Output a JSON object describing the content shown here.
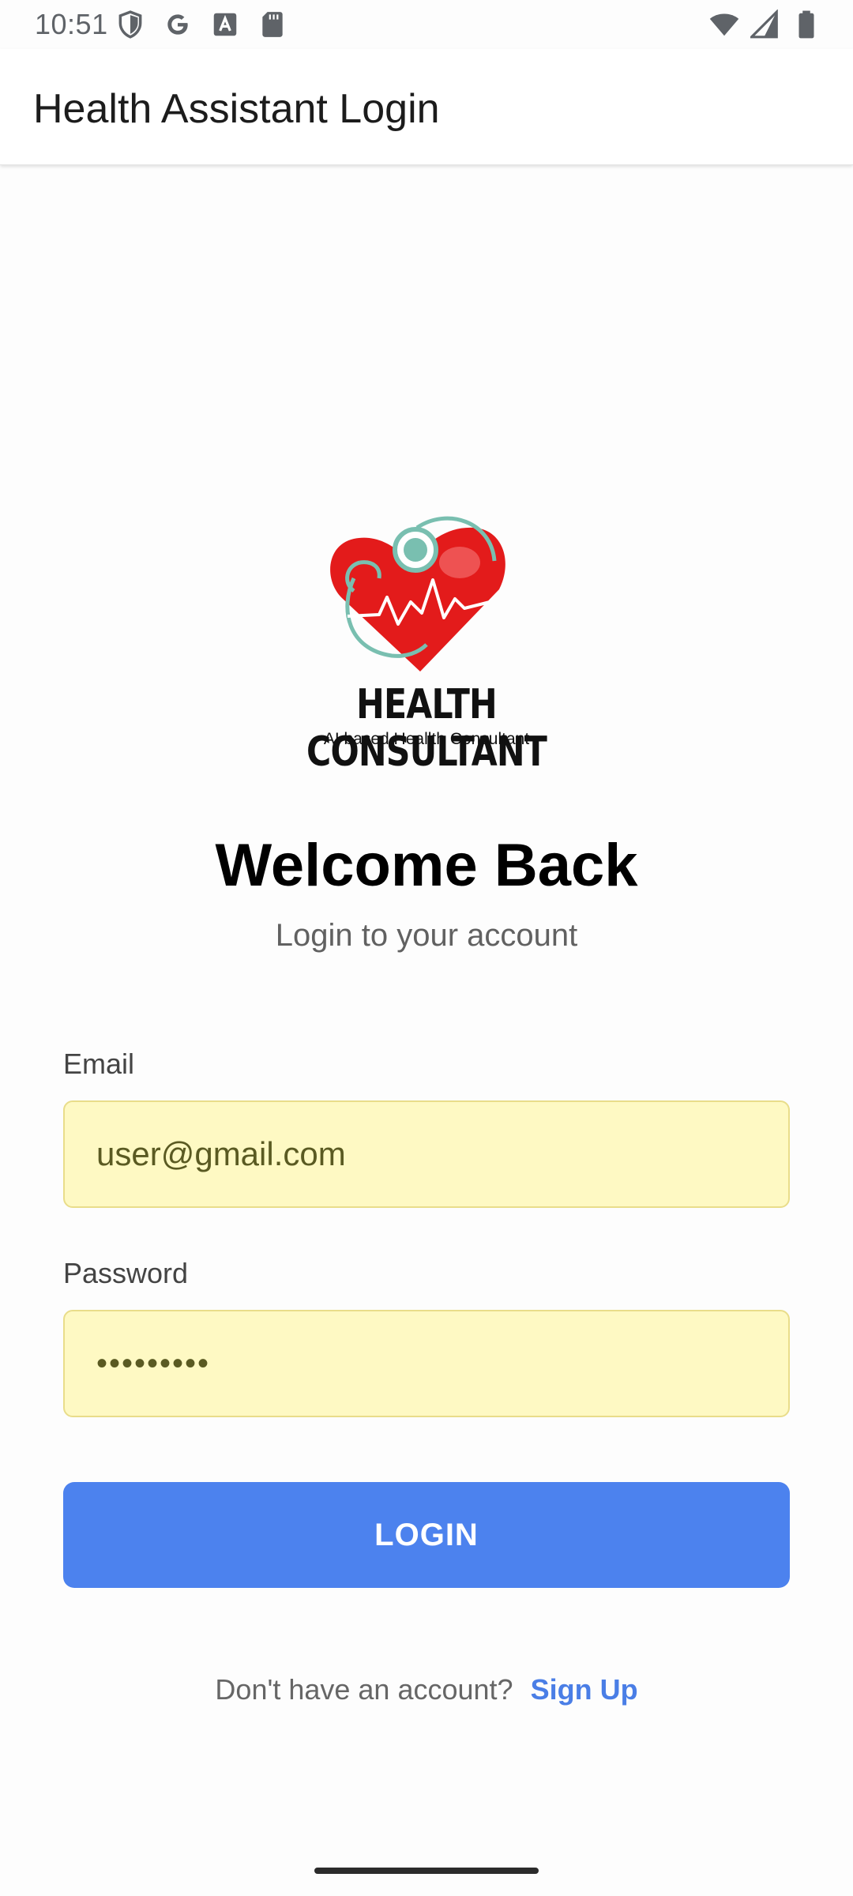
{
  "status_bar": {
    "time": "10:51",
    "left_icons": [
      "shield-icon",
      "google-icon",
      "font-icon",
      "sd-card-icon"
    ],
    "right_icons": [
      "wifi-icon",
      "signal-icon",
      "battery-icon"
    ]
  },
  "app_bar": {
    "title": "Health Assistant Login"
  },
  "logo": {
    "heading": "HEALTH CONSULTANT",
    "tagline": "AI based  Heallth Consultant",
    "colors": {
      "heart": "#e31b1b",
      "stethoscope": "#79bfb0"
    }
  },
  "welcome": {
    "title": "Welcome Back",
    "subtitle": "Login to your account"
  },
  "form": {
    "email_label": "Email",
    "email_value": "user@gmail.com",
    "password_label": "Password",
    "password_value": "•••••••••",
    "login_label": "LOGIN"
  },
  "footer": {
    "prompt": "Don't have an account?",
    "signup_label": "Sign Up"
  },
  "colors": {
    "primary": "#4c82ee",
    "input_bg": "#fef9c3",
    "link": "#4a7ee6"
  }
}
